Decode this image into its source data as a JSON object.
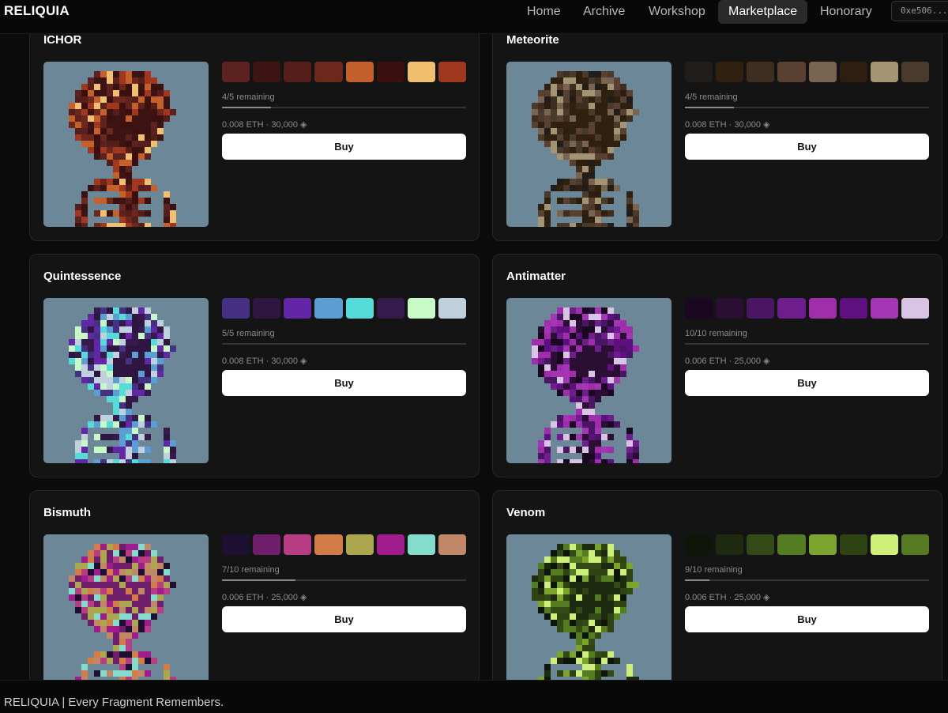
{
  "app": {
    "brand": "RELIQUIA"
  },
  "nav": {
    "items": [
      {
        "label": "Home",
        "active": false
      },
      {
        "label": "Archive",
        "active": false
      },
      {
        "label": "Workshop",
        "active": false
      },
      {
        "label": "Marketplace",
        "active": true
      },
      {
        "label": "Honorary",
        "active": false
      }
    ],
    "wallet": "0xe506..."
  },
  "cards": [
    {
      "name": "ICHOR",
      "palette": [
        "#5c2220",
        "#3c1412",
        "#551e1a",
        "#6d281e",
        "#c4602c",
        "#3a1110",
        "#f0c070",
        "#a03820"
      ],
      "remaining": "4/5 remaining",
      "progress": 0.2,
      "price": "0.008 ETH · 30,000 ◈",
      "buy": "Buy"
    },
    {
      "name": "Meteorite",
      "palette": [
        "#201d1a",
        "#302010",
        "#3f2e20",
        "#5a4030",
        "#786450",
        "#2e1e10",
        "#a49474",
        "#4a3a2c"
      ],
      "remaining": "4/5 remaining",
      "progress": 0.2,
      "price": "0.008 ETH · 30,000 ◈",
      "buy": "Buy"
    },
    {
      "name": "Quintessence",
      "palette": [
        "#463084",
        "#2e1640",
        "#6226a6",
        "#5a9ed4",
        "#56dcd8",
        "#361a4c",
        "#c8fac8",
        "#c0d0dc"
      ],
      "remaining": "5/5 remaining",
      "progress": 0.0,
      "price": "0.008 ETH · 30,000 ◈",
      "buy": "Buy"
    },
    {
      "name": "Antimatter",
      "palette": [
        "#1a0820",
        "#2a0e34",
        "#4a1664",
        "#6e1e8c",
        "#a02eac",
        "#5e1080",
        "#a436b6",
        "#d8c4e4"
      ],
      "remaining": "10/10 remaining",
      "progress": 0.0,
      "price": "0.006 ETH · 25,000 ◈",
      "buy": "Buy"
    },
    {
      "name": "Bismuth",
      "palette": [
        "#1e1032",
        "#6e1e6a",
        "#b83c84",
        "#d47c48",
        "#aca64e",
        "#a01c8c",
        "#84dccc",
        "#c08866"
      ],
      "remaining": "7/10 remaining",
      "progress": 0.3,
      "price": "0.006 ETH · 25,000 ◈",
      "buy": "Buy"
    },
    {
      "name": "Venom",
      "palette": [
        "#0e160a",
        "#1e2a10",
        "#344a16",
        "#547c22",
        "#7aa42e",
        "#2e4212",
        "#cef07a",
        "#567a22"
      ],
      "remaining": "9/10 remaining",
      "progress": 0.1,
      "price": "0.006 ETH · 25,000 ◈",
      "buy": "Buy"
    }
  ],
  "footer": {
    "text": "RELIQUIA | Every Fragment Remembers."
  }
}
